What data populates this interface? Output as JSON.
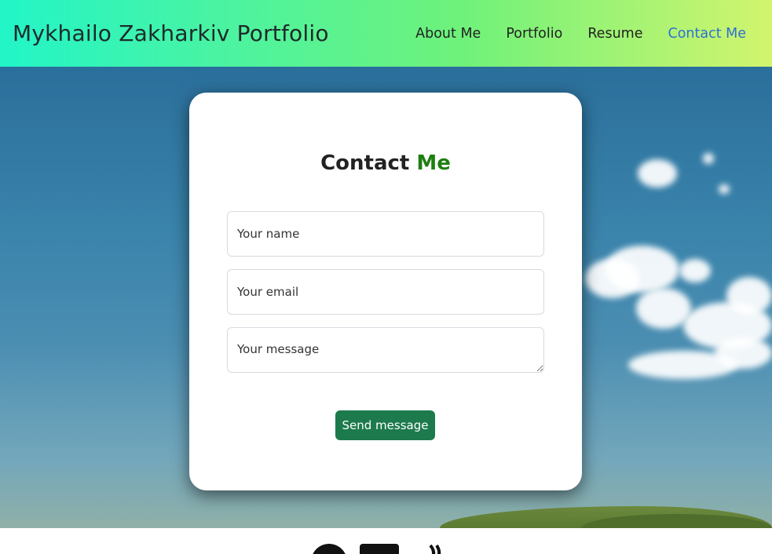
{
  "navbar": {
    "brand": "Mykhailo Zakharkiv Portfolio",
    "links": [
      {
        "label": "About Me",
        "active": false
      },
      {
        "label": "Portfolio",
        "active": false
      },
      {
        "label": "Resume",
        "active": false
      },
      {
        "label": "Contact Me",
        "active": true
      }
    ]
  },
  "contact": {
    "title_prefix": "Contact",
    "title_accent": "Me",
    "name_placeholder": "Your name",
    "email_placeholder": "Your email",
    "message_placeholder": "Your message",
    "send_label": "Send message"
  },
  "footer": {
    "icons": [
      "github-icon",
      "linkedin-icon",
      "feed-icon"
    ]
  },
  "colors": {
    "accent_green": "#1f7e12",
    "button_green": "#1c7a4c",
    "active_link": "#2f6fd6"
  }
}
